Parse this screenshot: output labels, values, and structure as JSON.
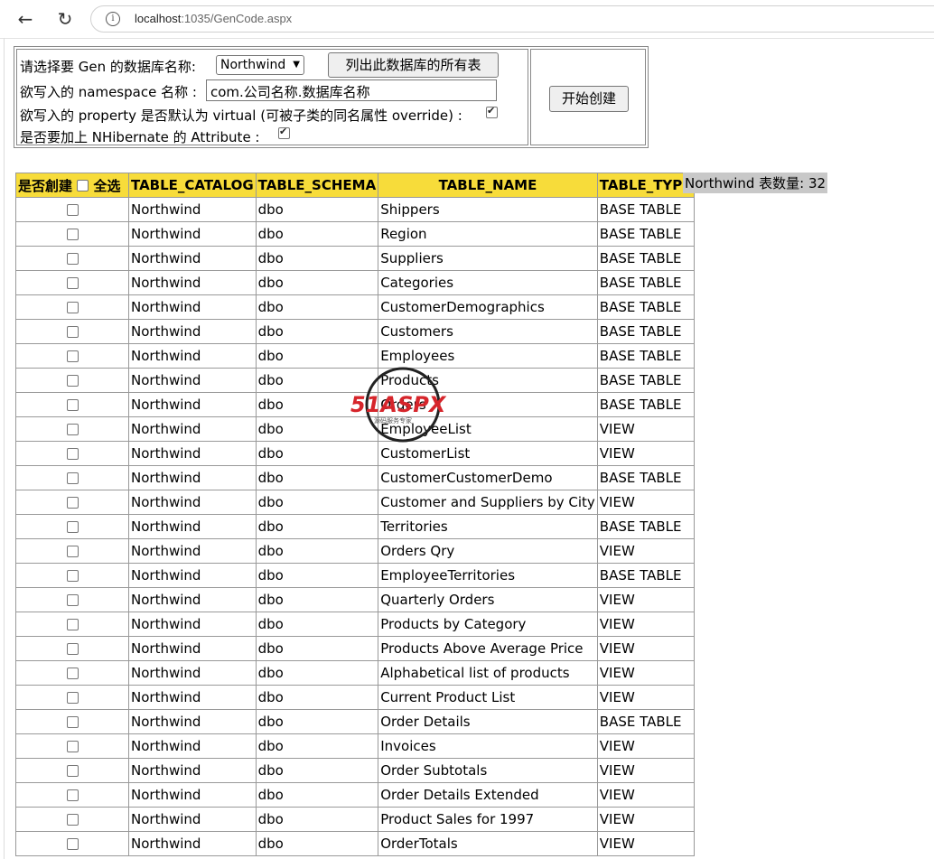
{
  "browser": {
    "url_host": "localhost",
    "url_rest": ":1035/GenCode.aspx"
  },
  "form": {
    "db_label": "请选择要 Gen 的数据库名称:",
    "db_selected": "Northwind",
    "list_tables_button": "列出此数据库的所有表",
    "namespace_label": "欲写入的 namespace 名称 :",
    "namespace_value": "com.公司名称.数据库名称",
    "virtual_label": "欲写入的 property 是否默认为 virtual (可被子类的同名属性 override) :",
    "virtual_checked": true,
    "attribute_label": "是否要加上 NHibernate 的 Attribute :",
    "attribute_checked": true,
    "start_button": "开始创建"
  },
  "table": {
    "headers": {
      "create": "是否創建",
      "select_all": "全选",
      "catalog": "TABLE_CATALOG",
      "schema": "TABLE_SCHEMA",
      "name": "TABLE_NAME",
      "type": "TABLE_TYPE"
    },
    "count_label": "Northwind 表数量: 32",
    "rows": [
      {
        "catalog": "Northwind",
        "schema": "dbo",
        "name": "Shippers",
        "type": "BASE TABLE"
      },
      {
        "catalog": "Northwind",
        "schema": "dbo",
        "name": "Region",
        "type": "BASE TABLE"
      },
      {
        "catalog": "Northwind",
        "schema": "dbo",
        "name": "Suppliers",
        "type": "BASE TABLE"
      },
      {
        "catalog": "Northwind",
        "schema": "dbo",
        "name": "Categories",
        "type": "BASE TABLE"
      },
      {
        "catalog": "Northwind",
        "schema": "dbo",
        "name": "CustomerDemographics",
        "type": "BASE TABLE"
      },
      {
        "catalog": "Northwind",
        "schema": "dbo",
        "name": "Customers",
        "type": "BASE TABLE"
      },
      {
        "catalog": "Northwind",
        "schema": "dbo",
        "name": "Employees",
        "type": "BASE TABLE"
      },
      {
        "catalog": "Northwind",
        "schema": "dbo",
        "name": "Products",
        "type": "BASE TABLE"
      },
      {
        "catalog": "Northwind",
        "schema": "dbo",
        "name": "Orders",
        "type": "BASE TABLE"
      },
      {
        "catalog": "Northwind",
        "schema": "dbo",
        "name": "EmployeeList",
        "type": "VIEW"
      },
      {
        "catalog": "Northwind",
        "schema": "dbo",
        "name": "CustomerList",
        "type": "VIEW"
      },
      {
        "catalog": "Northwind",
        "schema": "dbo",
        "name": "CustomerCustomerDemo",
        "type": "BASE TABLE"
      },
      {
        "catalog": "Northwind",
        "schema": "dbo",
        "name": "Customer and Suppliers by City",
        "type": "VIEW"
      },
      {
        "catalog": "Northwind",
        "schema": "dbo",
        "name": "Territories",
        "type": "BASE TABLE"
      },
      {
        "catalog": "Northwind",
        "schema": "dbo",
        "name": "Orders Qry",
        "type": "VIEW"
      },
      {
        "catalog": "Northwind",
        "schema": "dbo",
        "name": "EmployeeTerritories",
        "type": "BASE TABLE"
      },
      {
        "catalog": "Northwind",
        "schema": "dbo",
        "name": "Quarterly Orders",
        "type": "VIEW"
      },
      {
        "catalog": "Northwind",
        "schema": "dbo",
        "name": "Products by Category",
        "type": "VIEW"
      },
      {
        "catalog": "Northwind",
        "schema": "dbo",
        "name": "Products Above Average Price",
        "type": "VIEW"
      },
      {
        "catalog": "Northwind",
        "schema": "dbo",
        "name": "Alphabetical list of products",
        "type": "VIEW"
      },
      {
        "catalog": "Northwind",
        "schema": "dbo",
        "name": "Current Product List",
        "type": "VIEW"
      },
      {
        "catalog": "Northwind",
        "schema": "dbo",
        "name": "Order Details",
        "type": "BASE TABLE"
      },
      {
        "catalog": "Northwind",
        "schema": "dbo",
        "name": "Invoices",
        "type": "VIEW"
      },
      {
        "catalog": "Northwind",
        "schema": "dbo",
        "name": "Order Subtotals",
        "type": "VIEW"
      },
      {
        "catalog": "Northwind",
        "schema": "dbo",
        "name": "Order Details Extended",
        "type": "VIEW"
      },
      {
        "catalog": "Northwind",
        "schema": "dbo",
        "name": "Product Sales for 1997",
        "type": "VIEW"
      },
      {
        "catalog": "Northwind",
        "schema": "dbo",
        "name": "OrderTotals",
        "type": "VIEW"
      }
    ]
  },
  "watermark": {
    "brand": "51ASPX",
    "tagline": "源码服务专家"
  },
  "colors": {
    "header_bg": "#f7dc3a",
    "count_bg": "#c8c8c8"
  }
}
